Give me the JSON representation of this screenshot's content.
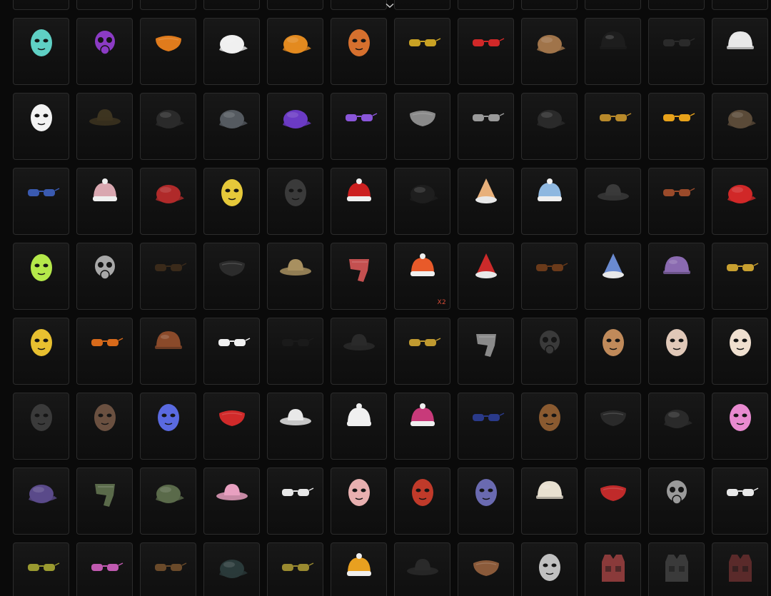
{
  "inventory": {
    "columns": 12,
    "scroll_indicator_icon": "chevron-down-icon",
    "items": [
      {
        "icon": "cap-icon",
        "color": "#3a3a3a",
        "kind": "cap"
      },
      {
        "icon": "cap-icon",
        "color": "#3a3a3a",
        "kind": "cap"
      },
      {
        "icon": "hat-icon",
        "color": "#3a3a3a",
        "kind": "cap"
      },
      {
        "icon": "hat-icon",
        "color": "#3a3a3a",
        "kind": "cap"
      },
      {
        "icon": "hat-icon",
        "color": "#3a3a3a",
        "kind": "cap"
      },
      {
        "icon": "hat-icon",
        "color": "#3a3a3a",
        "kind": "cap"
      },
      {
        "icon": "hat-icon",
        "color": "#3a3a3a",
        "kind": "cap"
      },
      {
        "icon": "hat-icon",
        "color": "#3a3a3a",
        "kind": "cap"
      },
      {
        "icon": "hat-icon",
        "color": "#3a3a3a",
        "kind": "cap"
      },
      {
        "icon": "hat-icon",
        "color": "#3a3a3a",
        "kind": "cap"
      },
      {
        "icon": "hat-icon",
        "color": "#3a3a3a",
        "kind": "cap"
      },
      {
        "icon": "hat-icon",
        "color": "#3a3a3a",
        "kind": "cap"
      },
      {
        "icon": "owl-mask-icon",
        "color": "#5fd0c4",
        "kind": "head"
      },
      {
        "icon": "gas-mask-icon",
        "color": "#8b3bc4",
        "kind": "gasmask"
      },
      {
        "icon": "face-mask-icon",
        "color": "#e07b1c",
        "kind": "mask"
      },
      {
        "icon": "baseball-cap-icon",
        "color": "#f0f0f0",
        "kind": "cap"
      },
      {
        "icon": "baseball-cap-icon",
        "color": "#e38a1f",
        "kind": "cap"
      },
      {
        "icon": "fox-mask-icon",
        "color": "#d6702e",
        "kind": "head"
      },
      {
        "icon": "sunglasses-icon",
        "color": "#c9a224",
        "kind": "glasses"
      },
      {
        "icon": "sport-glasses-icon",
        "color": "#d12828",
        "kind": "glasses"
      },
      {
        "icon": "aviator-hat-icon",
        "color": "#a0744a",
        "kind": "cap"
      },
      {
        "icon": "motorcycle-helmet-icon",
        "color": "#1d1d1d",
        "kind": "helmet"
      },
      {
        "icon": "sunglasses-icon",
        "color": "#2a2a2a",
        "kind": "glasses"
      },
      {
        "icon": "robot-helmet-icon",
        "color": "#e8e8e8",
        "kind": "helmet"
      },
      {
        "icon": "clown-mask-icon",
        "color": "#f2f2f2",
        "kind": "head"
      },
      {
        "icon": "bucket-hat-icon",
        "color": "#3d3420",
        "kind": "bucket"
      },
      {
        "icon": "beret-icon",
        "color": "#2a2a2a",
        "kind": "cap"
      },
      {
        "icon": "garrison-cap-icon",
        "color": "#555a60",
        "kind": "cap"
      },
      {
        "icon": "headset-cap-icon",
        "color": "#6b3bc4",
        "kind": "cap"
      },
      {
        "icon": "sunglasses-icon",
        "color": "#8a56d9",
        "kind": "glasses"
      },
      {
        "icon": "half-mask-icon",
        "color": "#8a8a8a",
        "kind": "mask"
      },
      {
        "icon": "goggles-icon",
        "color": "#9a9a9a",
        "kind": "glasses"
      },
      {
        "icon": "baseball-cap-icon",
        "color": "#2a2a2a",
        "kind": "cap"
      },
      {
        "icon": "sunglasses-icon",
        "color": "#b8892a",
        "kind": "glasses"
      },
      {
        "icon": "glasses-icon",
        "color": "#e8a21a",
        "kind": "glasses"
      },
      {
        "icon": "aviator-cap-icon",
        "color": "#5a4a38",
        "kind": "cap"
      },
      {
        "icon": "steampunk-goggles-icon",
        "color": "#3a5ab0",
        "kind": "glasses"
      },
      {
        "icon": "pompom-beanie-icon",
        "color": "#d9a7b0",
        "kind": "beanie"
      },
      {
        "icon": "beret-icon",
        "color": "#b02a2a",
        "kind": "cap"
      },
      {
        "icon": "gold-mask-icon",
        "color": "#e6c93a",
        "kind": "head"
      },
      {
        "icon": "balaclava-icon",
        "color": "#3a3a3a",
        "kind": "head"
      },
      {
        "icon": "santa-hat-icon",
        "color": "#cc2020",
        "kind": "beanie"
      },
      {
        "icon": "officer-cap-icon",
        "color": "#1e1e1e",
        "kind": "cap"
      },
      {
        "icon": "ice-cream-hat-icon",
        "color": "#e8b07a",
        "kind": "cone"
      },
      {
        "icon": "bee-hat-icon",
        "color": "#8fb8e0",
        "kind": "beanie"
      },
      {
        "icon": "cowboy-hat-icon",
        "color": "#3a3a3a",
        "kind": "bucket"
      },
      {
        "icon": "glasses-icon",
        "color": "#9a4a2a",
        "kind": "glasses"
      },
      {
        "icon": "baseball-cap-icon",
        "color": "#d12828",
        "kind": "cap"
      },
      {
        "icon": "ski-mask-icon",
        "color": "#b4e84a",
        "kind": "head"
      },
      {
        "icon": "respirator-icon",
        "color": "#a8a8a8",
        "kind": "gasmask"
      },
      {
        "icon": "sunglasses-icon",
        "color": "#3a2a1a",
        "kind": "glasses"
      },
      {
        "icon": "face-mask-icon",
        "color": "#2c2c2c",
        "kind": "mask"
      },
      {
        "icon": "boonie-hat-icon",
        "color": "#a89060",
        "kind": "bucket"
      },
      {
        "icon": "scarf-icon",
        "color": "#c45050",
        "kind": "scarf"
      },
      {
        "icon": "winter-beanie-icon",
        "color": "#e85a2a",
        "kind": "beanie",
        "qty": "X2"
      },
      {
        "icon": "elf-hat-icon",
        "color": "#cc2a2a",
        "kind": "cone"
      },
      {
        "icon": "sunglasses-icon",
        "color": "#6a3a1a",
        "kind": "glasses"
      },
      {
        "icon": "wizard-hat-icon",
        "color": "#6a8ad0",
        "kind": "cone"
      },
      {
        "icon": "pith-helmet-icon",
        "color": "#8a6ab0",
        "kind": "helmet"
      },
      {
        "icon": "round-glasses-icon",
        "color": "#c8a030",
        "kind": "glasses"
      },
      {
        "icon": "chicken-mask-icon",
        "color": "#e8c030",
        "kind": "head"
      },
      {
        "icon": "round-sunglasses-icon",
        "color": "#d86a1a",
        "kind": "glasses"
      },
      {
        "icon": "diving-helmet-icon",
        "color": "#8a4a2a",
        "kind": "helmet"
      },
      {
        "icon": "sunglasses-icon",
        "color": "#f0f0f0",
        "kind": "glasses"
      },
      {
        "icon": "sunglasses-icon",
        "color": "#1a1a1a",
        "kind": "glasses"
      },
      {
        "icon": "cowboy-hat-icon",
        "color": "#2a2a2a",
        "kind": "bucket"
      },
      {
        "icon": "steampunk-goggles-icon",
        "color": "#c09a30",
        "kind": "glasses"
      },
      {
        "icon": "bandana-icon",
        "color": "#8a8a8a",
        "kind": "scarf"
      },
      {
        "icon": "respirator-icon",
        "color": "#3a3a3a",
        "kind": "gasmask"
      },
      {
        "icon": "face-paint-head-icon",
        "color": "#c08a5a",
        "kind": "head"
      },
      {
        "icon": "hockey-mask-icon",
        "color": "#e0c8b8",
        "kind": "head"
      },
      {
        "icon": "cat-headband-icon",
        "color": "#f0e0d0",
        "kind": "head"
      },
      {
        "icon": "crow-mask-icon",
        "color": "#3a3a3a",
        "kind": "head"
      },
      {
        "icon": "ram-mask-icon",
        "color": "#6a5040",
        "kind": "head"
      },
      {
        "icon": "robot-headphones-icon",
        "color": "#5a6ae0",
        "kind": "head"
      },
      {
        "icon": "eye-mask-icon",
        "color": "#d02a2a",
        "kind": "mask"
      },
      {
        "icon": "cowboy-hat-icon",
        "color": "#e8e8e8",
        "kind": "bucket"
      },
      {
        "icon": "bear-beanie-icon",
        "color": "#f0f0f0",
        "kind": "beanie"
      },
      {
        "icon": "beanie-icon",
        "color": "#c83a7a",
        "kind": "beanie"
      },
      {
        "icon": "square-sunglasses-icon",
        "color": "#2a3a8a",
        "kind": "glasses"
      },
      {
        "icon": "monkey-mask-icon",
        "color": "#8a5a30",
        "kind": "head"
      },
      {
        "icon": "eye-mask-icon",
        "color": "#2a2a2a",
        "kind": "mask"
      },
      {
        "icon": "cat-ear-hat-icon",
        "color": "#2a2a2a",
        "kind": "cap"
      },
      {
        "icon": "cat-ear-wig-icon",
        "color": "#e88ad0",
        "kind": "head"
      },
      {
        "icon": "officer-cap-icon",
        "color": "#5a4a8a",
        "kind": "cap"
      },
      {
        "icon": "camo-neck-gaiter-icon",
        "color": "#5a6a4a",
        "kind": "scarf"
      },
      {
        "icon": "headset-cap-icon",
        "color": "#5a6a4a",
        "kind": "cap"
      },
      {
        "icon": "bunny-bucket-hat-icon",
        "color": "#e8a0c0",
        "kind": "bucket"
      },
      {
        "icon": "visor-glasses-icon",
        "color": "#e8e8e8",
        "kind": "glasses"
      },
      {
        "icon": "bunny-mask-icon",
        "color": "#e8b0b0",
        "kind": "head"
      },
      {
        "icon": "oni-mask-icon",
        "color": "#c03a2a",
        "kind": "head"
      },
      {
        "icon": "purple-mask-icon",
        "color": "#6a6ab0",
        "kind": "head"
      },
      {
        "icon": "sailor-helmet-icon",
        "color": "#e8e0d0",
        "kind": "helmet"
      },
      {
        "icon": "dragon-mask-icon",
        "color": "#c02a2a",
        "kind": "mask"
      },
      {
        "icon": "muzzle-mask-icon",
        "color": "#9a9a9a",
        "kind": "gasmask"
      },
      {
        "icon": "earpiece-icon",
        "color": "#e8e8e8",
        "kind": "glasses"
      },
      {
        "icon": "sunglasses-icon",
        "color": "#9a9a30",
        "kind": "glasses"
      },
      {
        "icon": "visor-icon",
        "color": "#c05ab0",
        "kind": "glasses"
      },
      {
        "icon": "sunglasses-icon",
        "color": "#6a4a2a",
        "kind": "glasses"
      },
      {
        "icon": "baseball-cap-icon",
        "color": "#2a3a3a",
        "kind": "cap"
      },
      {
        "icon": "square-glasses-icon",
        "color": "#9a8a30",
        "kind": "glasses"
      },
      {
        "icon": "beanie-icon",
        "color": "#e8a020",
        "kind": "beanie"
      },
      {
        "icon": "bucket-hat-icon",
        "color": "#2a2a2a",
        "kind": "bucket"
      },
      {
        "icon": "mustache-icon",
        "color": "#8a5a3a",
        "kind": "mask"
      },
      {
        "icon": "bear-mask-icon",
        "color": "#c0c0c0",
        "kind": "head"
      },
      {
        "icon": "tactical-vest-icon",
        "color": "#8a3a3a",
        "kind": "vest"
      },
      {
        "icon": "tactical-vest-icon",
        "color": "#3a3a3a",
        "kind": "vest"
      },
      {
        "icon": "tactical-vest-icon",
        "color": "#5a2a2a",
        "kind": "vest"
      }
    ]
  }
}
